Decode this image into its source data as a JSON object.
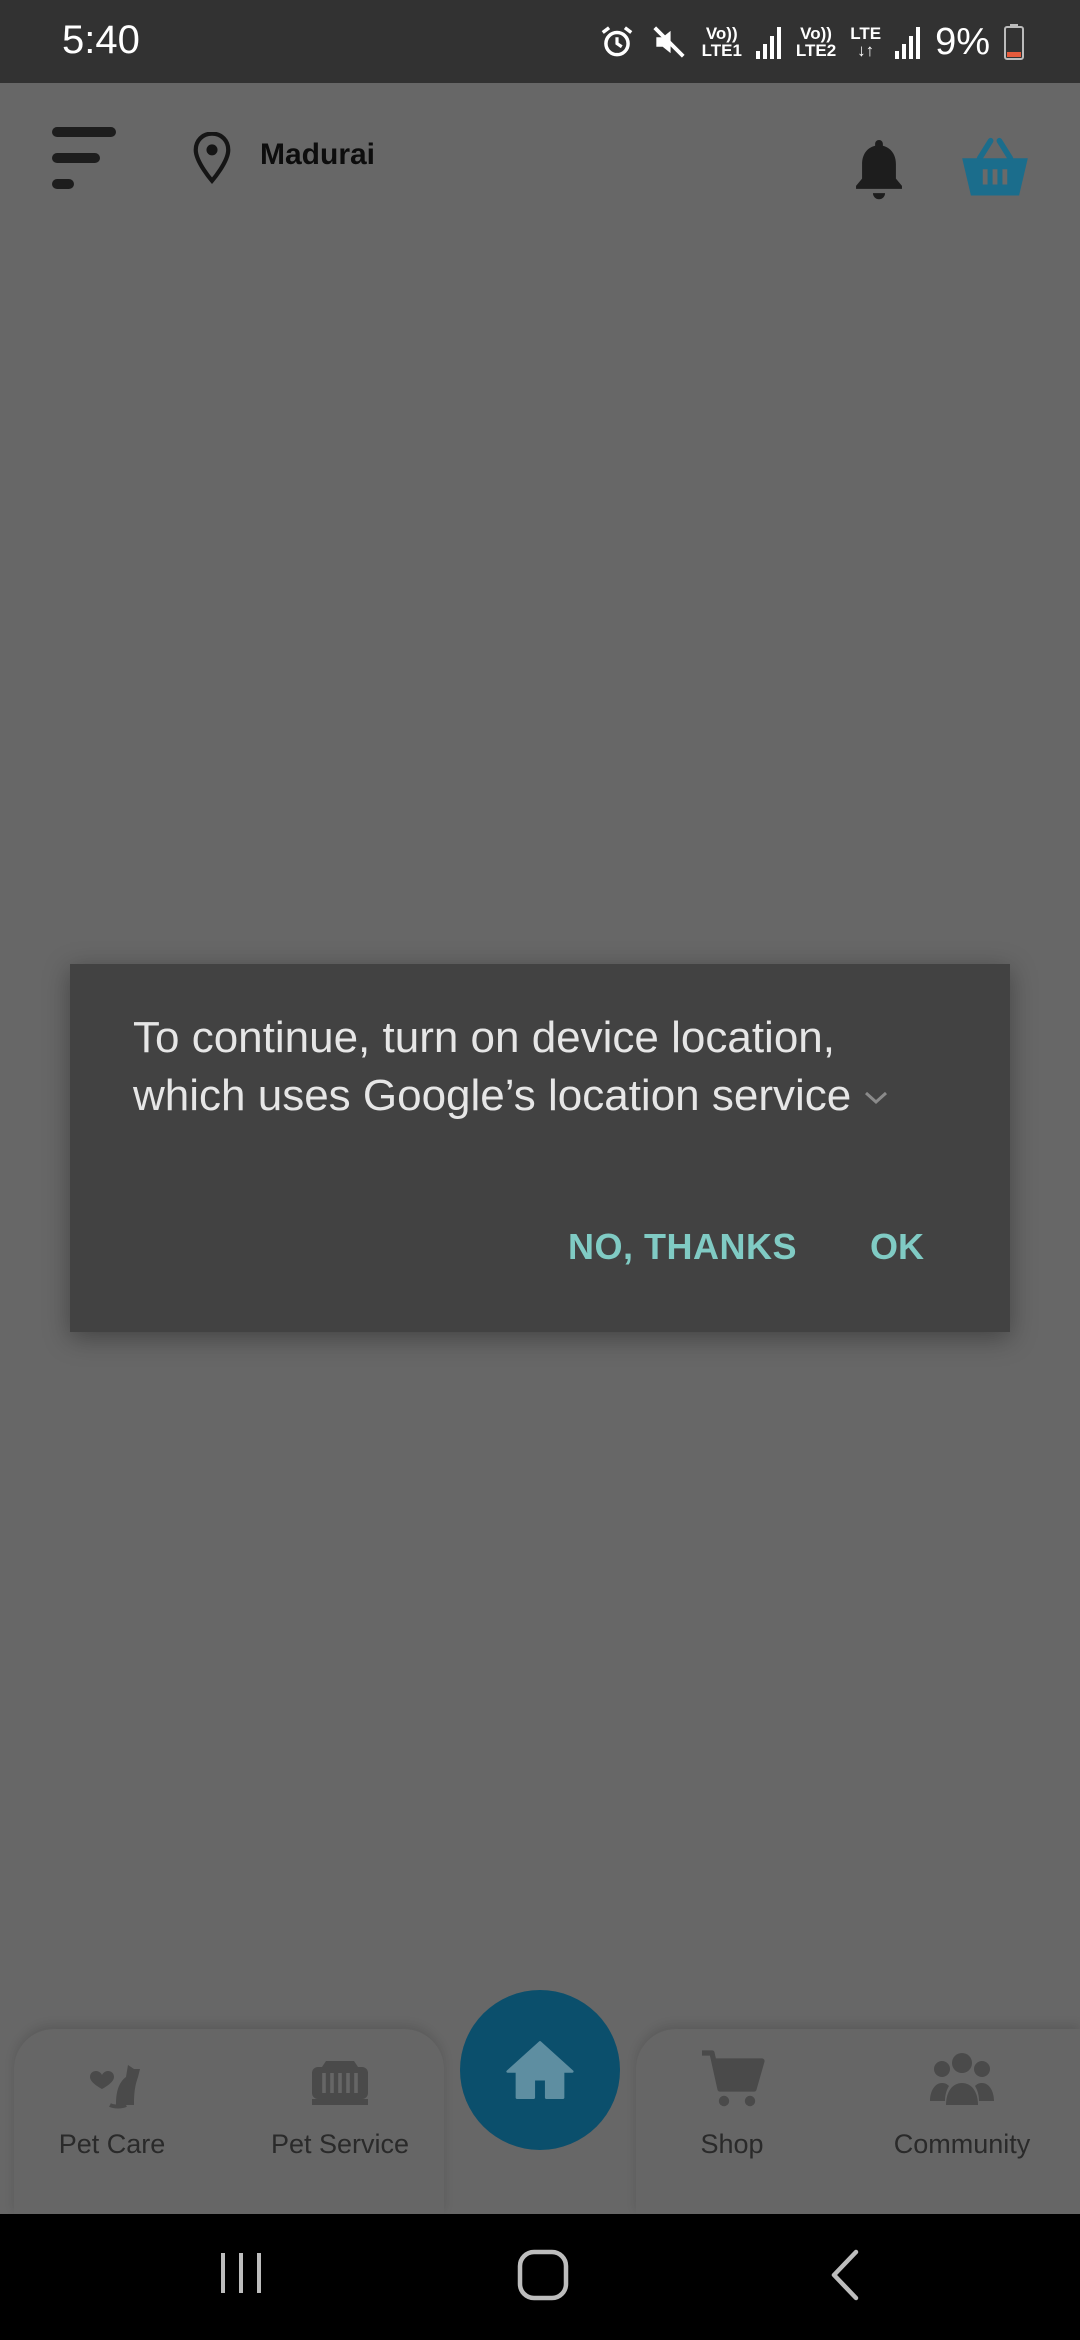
{
  "status_bar": {
    "time": "5:40",
    "icons": [
      "alarm-icon",
      "mute-icon",
      "signal-icon",
      "signal-icon",
      "battery-icon"
    ],
    "sim1": {
      "top": "Vo))",
      "bottom": "LTE1"
    },
    "sim2": {
      "top": "Vo))",
      "bottom": "LTE2"
    },
    "data": {
      "top": "LTE",
      "bottom": "↓↑"
    },
    "battery": "9%"
  },
  "header": {
    "location": "Madurai",
    "colors": {
      "basket": "#1b6d8c",
      "icons": "#1d1d1d"
    }
  },
  "dialog": {
    "message": "To continue, turn on device location, which uses Google’s location service",
    "negative": "NO, THANKS",
    "positive": "OK",
    "accent": "#80cbc4"
  },
  "bottom_nav": {
    "items": [
      {
        "label": "Pet Care",
        "icon": "pet-care-icon"
      },
      {
        "label": "Pet Service",
        "icon": "pet-carrier-icon"
      },
      {
        "label": "Shop",
        "icon": "cart-icon"
      },
      {
        "label": "Community",
        "icon": "community-icon"
      }
    ],
    "home_icon": "home-icon",
    "home_color": "#0b4f6c"
  }
}
